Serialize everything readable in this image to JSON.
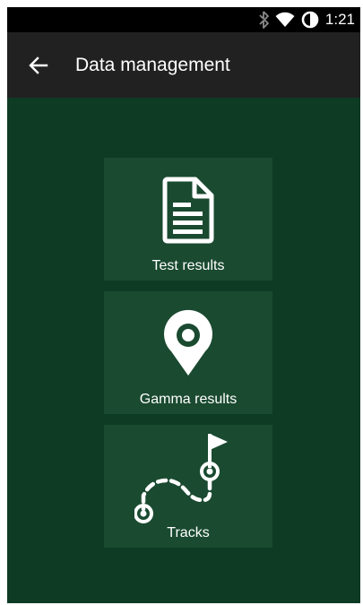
{
  "status_bar": {
    "icons": [
      "bluetooth-icon",
      "wifi-icon",
      "battery-icon"
    ],
    "time": "1:21"
  },
  "app_bar": {
    "back_icon": "arrow-left-icon",
    "title": "Data management"
  },
  "tiles": [
    {
      "label": "Test results",
      "icon": "document-icon"
    },
    {
      "label": "Gamma results",
      "icon": "map-pin-icon"
    },
    {
      "label": "Tracks",
      "icon": "track-route-icon"
    }
  ],
  "colors": {
    "background": "#0d3b24",
    "tile": "#1a4a30",
    "app_bar": "#212121",
    "status_bar": "#000000",
    "icon": "#ffffff"
  }
}
